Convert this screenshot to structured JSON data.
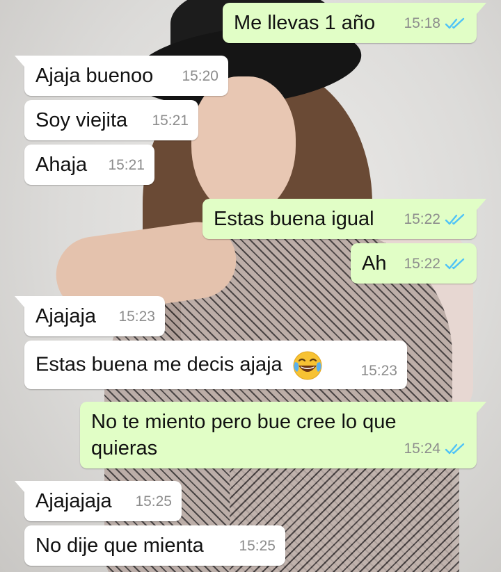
{
  "messages": [
    {
      "dir": "out",
      "text": "Me llevas 1 año",
      "time": "15:18",
      "tail": true
    },
    {
      "dir": "in",
      "text": "Ajaja buenoo",
      "time": "15:20",
      "tail": true
    },
    {
      "dir": "in",
      "text": "Soy viejita",
      "time": "15:21",
      "tail": false
    },
    {
      "dir": "in",
      "text": "Ahaja",
      "time": "15:21",
      "tail": false
    },
    {
      "dir": "out",
      "text": "Estas buena igual",
      "time": "15:22",
      "tail": true
    },
    {
      "dir": "out",
      "text": "Ah",
      "time": "15:22",
      "tail": false
    },
    {
      "dir": "in",
      "text": "Ajajaja",
      "time": "15:23",
      "tail": true
    },
    {
      "dir": "in",
      "text": "Estas buena me decis ajaja",
      "time": "15:23",
      "tail": false,
      "emoji": "face-with-tears-of-joy"
    },
    {
      "dir": "out",
      "text": "No te miento pero bue cree lo que quieras",
      "time": "15:24",
      "tail": true
    },
    {
      "dir": "in",
      "text": "Ajajajaja",
      "time": "15:25",
      "tail": true
    },
    {
      "dir": "in",
      "text": "No dije que mienta",
      "time": "15:25",
      "tail": false
    }
  ],
  "colors": {
    "incoming_bubble": "#ffffff",
    "outgoing_bubble": "#e1fec6",
    "read_ticks": "#4fc3f7",
    "timestamp": "#8c8c8c"
  },
  "icons": {
    "read_receipt": "double-check-icon"
  }
}
